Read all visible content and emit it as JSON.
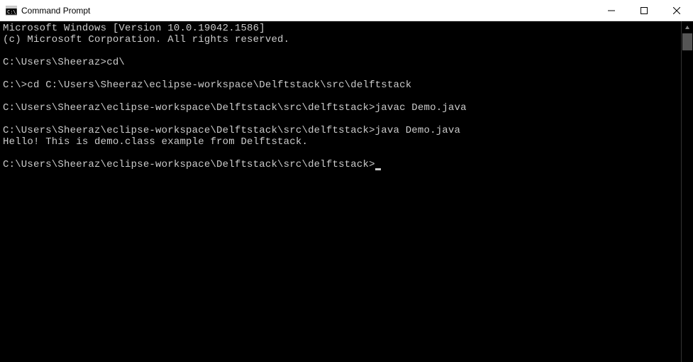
{
  "window": {
    "title": "Command Prompt"
  },
  "terminal": {
    "lines": [
      "Microsoft Windows [Version 10.0.19042.1586]",
      "(c) Microsoft Corporation. All rights reserved.",
      "",
      "C:\\Users\\Sheeraz>cd\\",
      "",
      "C:\\>cd C:\\Users\\Sheeraz\\eclipse-workspace\\Delftstack\\src\\delftstack",
      "",
      "C:\\Users\\Sheeraz\\eclipse-workspace\\Delftstack\\src\\delftstack>javac Demo.java",
      "",
      "C:\\Users\\Sheeraz\\eclipse-workspace\\Delftstack\\src\\delftstack>java Demo.java",
      "Hello! This is demo.class example from Delftstack.",
      "",
      "C:\\Users\\Sheeraz\\eclipse-workspace\\Delftstack\\src\\delftstack>"
    ]
  }
}
